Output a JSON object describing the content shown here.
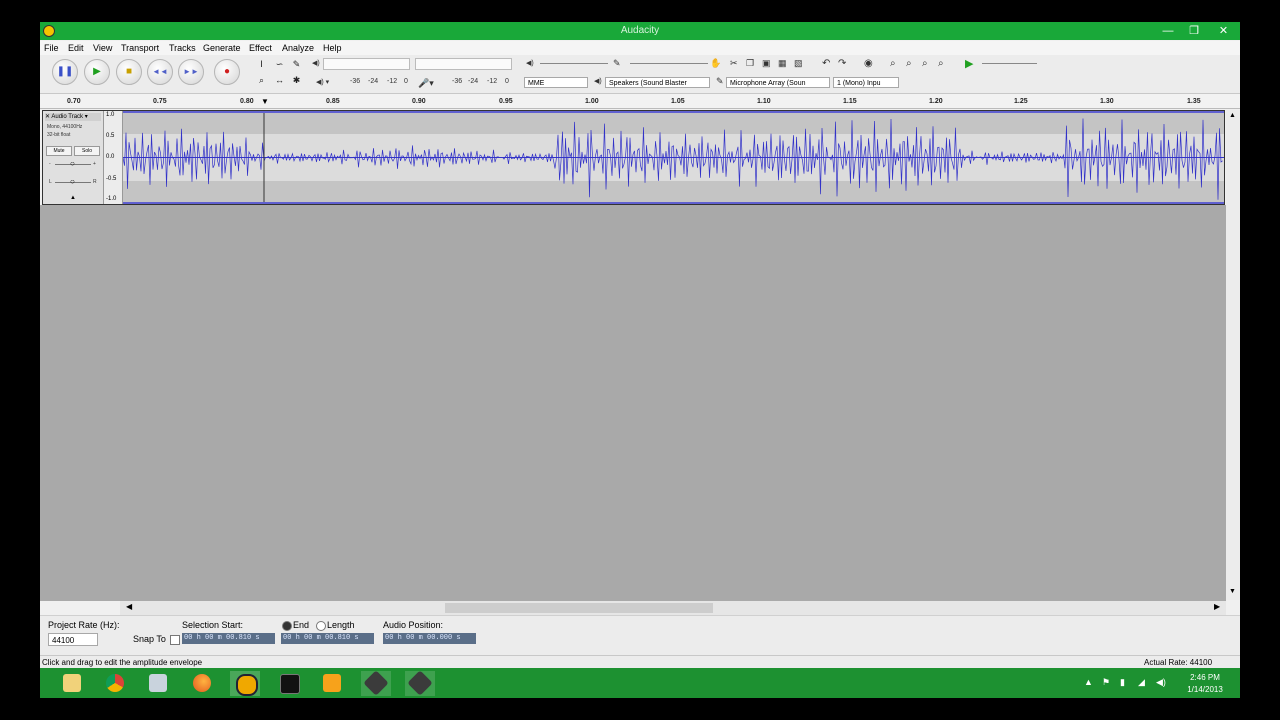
{
  "window": {
    "title": "Audacity"
  },
  "menu": [
    "File",
    "Edit",
    "View",
    "Transport",
    "Tracks",
    "Generate",
    "Effect",
    "Analyze",
    "Help"
  ],
  "meters": {
    "playback_scale": [
      "-36",
      "-24",
      "-12",
      "0"
    ],
    "record_scale": [
      "-36",
      "-24",
      "-12",
      "0"
    ]
  },
  "device": {
    "host": "MME",
    "output": "Speakers (Sound Blaster",
    "input": "Microphone Array (Soun",
    "channels": "1 (Mono) Inpu"
  },
  "ruler": {
    "ticks": [
      "0.70",
      "0.75",
      "0.80",
      "0.85",
      "0.90",
      "0.95",
      "1.00",
      "1.05",
      "1.10",
      "1.15",
      "1.20",
      "1.25",
      "1.30",
      "1.35"
    ]
  },
  "track": {
    "name": "Audio Track",
    "info1": "Mono, 44100Hz",
    "info2": "32-bit float",
    "mute": "Mute",
    "solo": "Solo",
    "lr": [
      "L",
      "R"
    ],
    "scale": [
      "1.0",
      "0.5",
      "0.0",
      "-0.5",
      "-1.0"
    ]
  },
  "selection_toolbar": {
    "project_rate_label": "Project Rate (Hz):",
    "project_rate": "44100",
    "snap_to_label": "Snap To",
    "selection_start_label": "Selection Start:",
    "end_label": "End",
    "length_label": "Length",
    "audio_position_label": "Audio Position:",
    "selection_start": "00 h 00 m 00.810 s",
    "selection_end": "00 h 00 m 00.810 s",
    "audio_position": "00 h 00 m 00.000 s"
  },
  "status": {
    "message": "Click and drag to edit the amplitude envelope",
    "actual_rate": "Actual Rate: 44100"
  },
  "clock": {
    "time": "2:46 PM",
    "date": "1/14/2013"
  },
  "colors": {
    "titlebar": "#19a839",
    "taskbar": "#1d9131",
    "waveform": "#3232c8",
    "workspace": "#a9a9a9"
  },
  "icons": [
    "pause-icon",
    "play-icon",
    "stop-icon",
    "skip-start-icon",
    "skip-end-icon",
    "record-icon"
  ]
}
